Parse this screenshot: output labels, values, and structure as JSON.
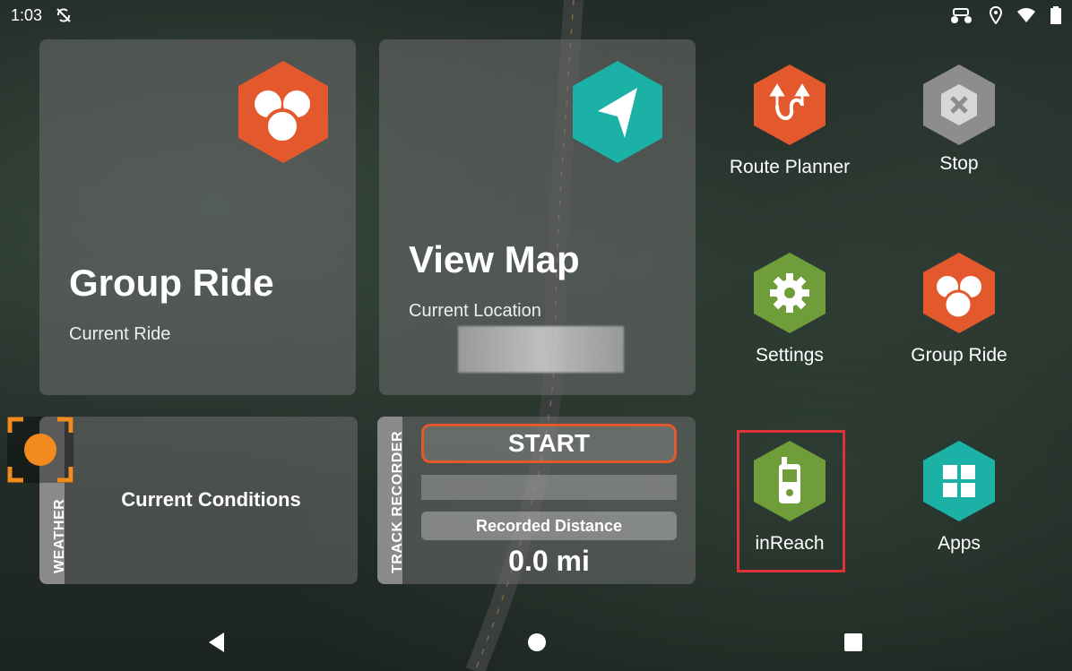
{
  "status_bar": {
    "time": "1:03",
    "icons_left": [
      "no-sync-icon"
    ],
    "icons_right": [
      "utv-icon",
      "location-icon",
      "wifi-icon",
      "battery-icon"
    ]
  },
  "cards": {
    "group_ride": {
      "title": "Group Ride",
      "subtitle": "Current Ride",
      "icon": "group-ride-icon",
      "color": "#e4582e"
    },
    "view_map": {
      "title": "View Map",
      "subtitle": "Current Location",
      "icon": "navigation-arrow-icon",
      "color": "#1bb1a6"
    },
    "weather": {
      "tab_label": "WEATHER",
      "text": "Current Conditions"
    },
    "track_recorder": {
      "tab_label": "TRACK RECORDER",
      "start_label": "START",
      "distance_label": "Recorded Distance",
      "distance_value": "0.0 mi"
    }
  },
  "apps": [
    {
      "label": "Route Planner",
      "icon": "route-planner-icon",
      "color": "#e4582e"
    },
    {
      "label": "Stop",
      "icon": "stop-icon",
      "color": "#8d8d8d"
    },
    {
      "label": "Settings",
      "icon": "gear-icon",
      "color": "#6e9d3a"
    },
    {
      "label": "Group Ride",
      "icon": "group-ride-icon",
      "color": "#e4582e"
    },
    {
      "label": "inReach",
      "icon": "inreach-device-icon",
      "color": "#6e9d3a"
    },
    {
      "label": "Apps",
      "icon": "apps-grid-icon",
      "color": "#1bb1a6"
    }
  ],
  "nav_bar": {
    "buttons": [
      "back-icon",
      "home-icon",
      "recents-icon"
    ]
  }
}
